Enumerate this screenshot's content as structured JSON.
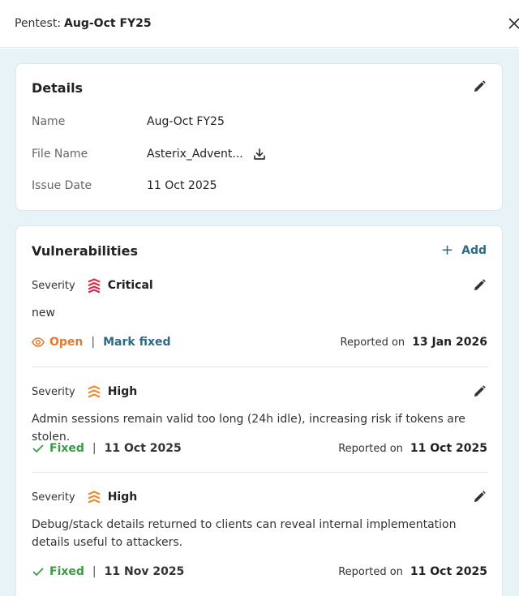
{
  "header": {
    "prefix": "Pentest:",
    "name": "Aug-Oct FY25",
    "close_icon": "close-icon"
  },
  "details": {
    "title": "Details",
    "rows": [
      {
        "label": "Name",
        "value": "Aug-Oct FY25"
      },
      {
        "label": "File Name",
        "value": "Asterix_Advent..."
      },
      {
        "label": "Issue Date",
        "value": "11 Oct 2025"
      }
    ]
  },
  "vulnerabilities": {
    "title": "Vulnerabilities",
    "add_label": "Add",
    "severity_label": "Severity",
    "reported_label": "Reported on",
    "items": [
      {
        "severity": "Critical",
        "severity_color": "#e0294a",
        "description": "new",
        "status": "Open",
        "status_color": "#e07a2c",
        "action": "Mark fixed",
        "reported": "13 Jan 2026"
      },
      {
        "severity": "High",
        "severity_color": "#ee8a2a",
        "description": "Admin sessions remain valid too long (24h idle), increasing risk if tokens are stolen.",
        "status": "Fixed",
        "status_color": "#3d9a47",
        "fixed_date": "11 Oct 2025",
        "reported": "11 Oct 2025"
      },
      {
        "severity": "High",
        "severity_color": "#ee8a2a",
        "description": "Debug/stack details returned to clients can reveal internal implementation details useful to attackers.",
        "status": "Fixed",
        "status_color": "#3d9a47",
        "fixed_date": "11 Nov 2025",
        "reported": "11 Oct 2025"
      }
    ]
  }
}
